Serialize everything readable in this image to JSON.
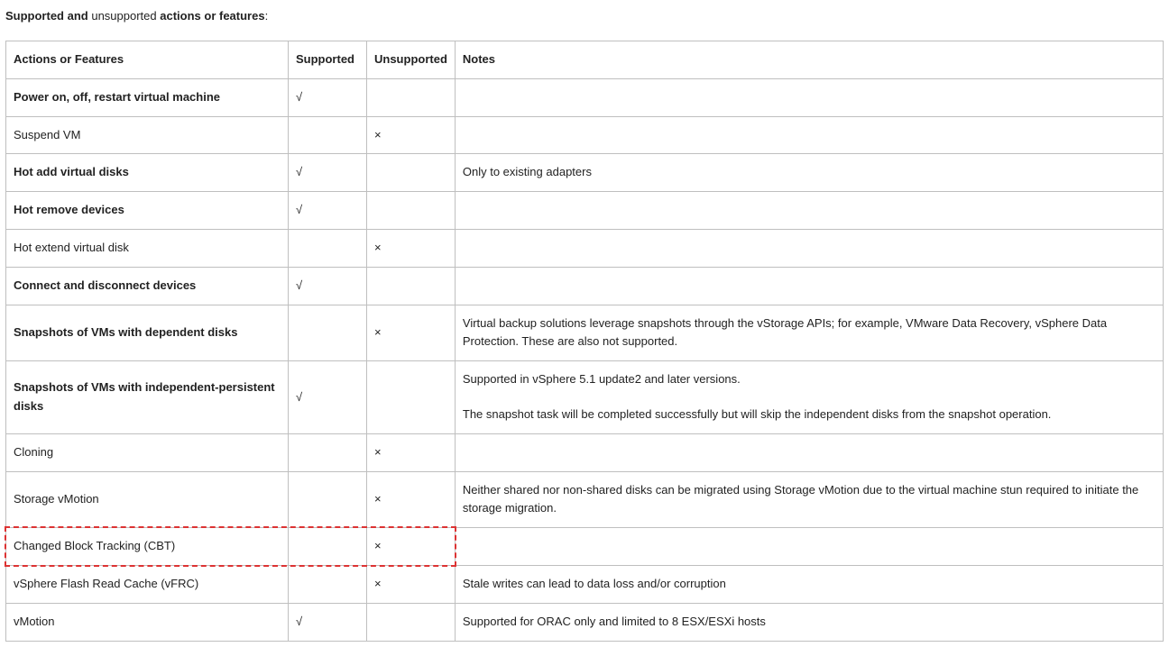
{
  "heading": {
    "part1": "Supported and ",
    "part2": "unsupported ",
    "part3": "actions or features",
    "part4": ":"
  },
  "columns": {
    "actions": "Actions or Features",
    "supported": "Supported",
    "unsupported": "Unsupported",
    "notes": "Notes"
  },
  "marks": {
    "check": "√",
    "cross": "×"
  },
  "rows": [
    {
      "label": "Power on, off, restart virtual machine",
      "bold": true,
      "supported": true,
      "unsupported": false,
      "notes": ""
    },
    {
      "label": "Suspend VM",
      "bold": false,
      "supported": false,
      "unsupported": true,
      "notes": ""
    },
    {
      "label": "Hot add virtual disks",
      "bold": true,
      "supported": true,
      "unsupported": false,
      "notes": "Only to existing adapters"
    },
    {
      "label": "Hot remove devices",
      "bold": true,
      "supported": true,
      "unsupported": false,
      "notes": ""
    },
    {
      "label": "Hot extend virtual disk",
      "bold": false,
      "supported": false,
      "unsupported": true,
      "notes": ""
    },
    {
      "label": "Connect and disconnect devices",
      "bold": true,
      "supported": true,
      "unsupported": false,
      "notes": ""
    },
    {
      "label": "Snapshots of VMs with dependent disks",
      "bold": true,
      "supported": false,
      "unsupported": true,
      "notes": "Virtual backup solutions leverage snapshots through the vStorage APIs; for example, VMware Data Recovery, vSphere Data Protection. These are also not supported."
    },
    {
      "label": "Snapshots of VMs with independent-persistent disks",
      "bold": true,
      "supported": true,
      "unsupported": false,
      "notes_multiline": [
        "Supported in vSphere 5.1 update2 and later versions.",
        "The snapshot task will be completed successfully but will skip the independent disks from the snapshot operation."
      ]
    },
    {
      "label": "Cloning",
      "bold": false,
      "supported": false,
      "unsupported": true,
      "notes": ""
    },
    {
      "label": "Storage vMotion",
      "bold": false,
      "supported": false,
      "unsupported": true,
      "notes": "Neither shared nor non-shared disks can be migrated using Storage vMotion due to the virtual machine stun required to initiate the storage migration."
    },
    {
      "label": "Changed Block Tracking (CBT)",
      "bold": false,
      "supported": false,
      "unsupported": true,
      "notes": "",
      "highlight": true
    },
    {
      "label": "vSphere Flash Read Cache (vFRC)",
      "bold": false,
      "supported": false,
      "unsupported": true,
      "notes": "Stale writes can lead to data loss and/or corruption"
    },
    {
      "label": "vMotion",
      "bold": false,
      "supported": true,
      "unsupported": false,
      "notes": "Supported for ORAC only and limited to 8 ESX/ESXi hosts"
    }
  ],
  "highlight": {
    "row_index": 10,
    "span_cols": 3
  }
}
